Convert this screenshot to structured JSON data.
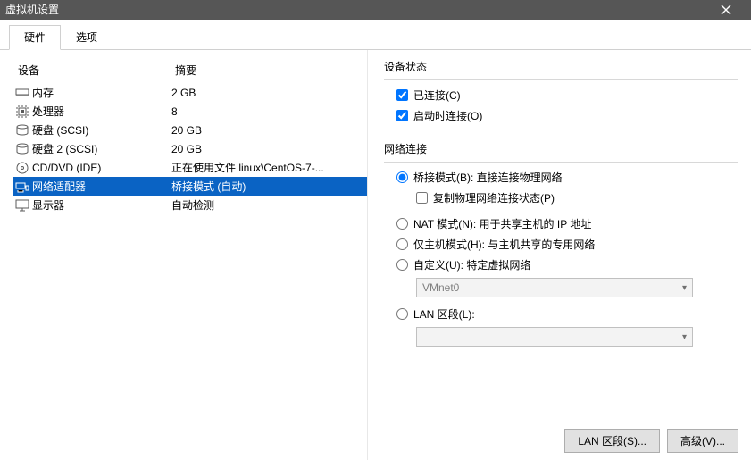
{
  "window": {
    "title": "虚拟机设置"
  },
  "tabs": {
    "hardware": "硬件",
    "options": "选项"
  },
  "headers": {
    "device": "设备",
    "summary": "摘要"
  },
  "devices": [
    {
      "icon": "memory",
      "name": "内存",
      "summary": "2 GB"
    },
    {
      "icon": "cpu",
      "name": "处理器",
      "summary": "8"
    },
    {
      "icon": "disk",
      "name": "硬盘 (SCSI)",
      "summary": "20 GB"
    },
    {
      "icon": "disk",
      "name": "硬盘 2 (SCSI)",
      "summary": "20 GB"
    },
    {
      "icon": "cd",
      "name": "CD/DVD (IDE)",
      "summary": "正在使用文件 linux\\CentOS-7-..."
    },
    {
      "icon": "net",
      "name": "网络适配器",
      "summary": "桥接模式 (自动)"
    },
    {
      "icon": "display",
      "name": "显示器",
      "summary": "自动检测"
    }
  ],
  "selected_index": 5,
  "status": {
    "title": "设备状态",
    "connected": "已连接(C)",
    "connect_at_poweron": "启动时连接(O)"
  },
  "network": {
    "title": "网络连接",
    "bridged": "桥接模式(B): 直接连接物理网络",
    "replicate": "复制物理网络连接状态(P)",
    "nat": "NAT 模式(N): 用于共享主机的 IP 地址",
    "hostonly": "仅主机模式(H): 与主机共享的专用网络",
    "custom": "自定义(U): 特定虚拟网络",
    "custom_combo": "VMnet0",
    "lanseg": "LAN 区段(L):",
    "lanseg_combo": ""
  },
  "buttons": {
    "lan_segments": "LAN 区段(S)...",
    "advanced": "高级(V)..."
  }
}
